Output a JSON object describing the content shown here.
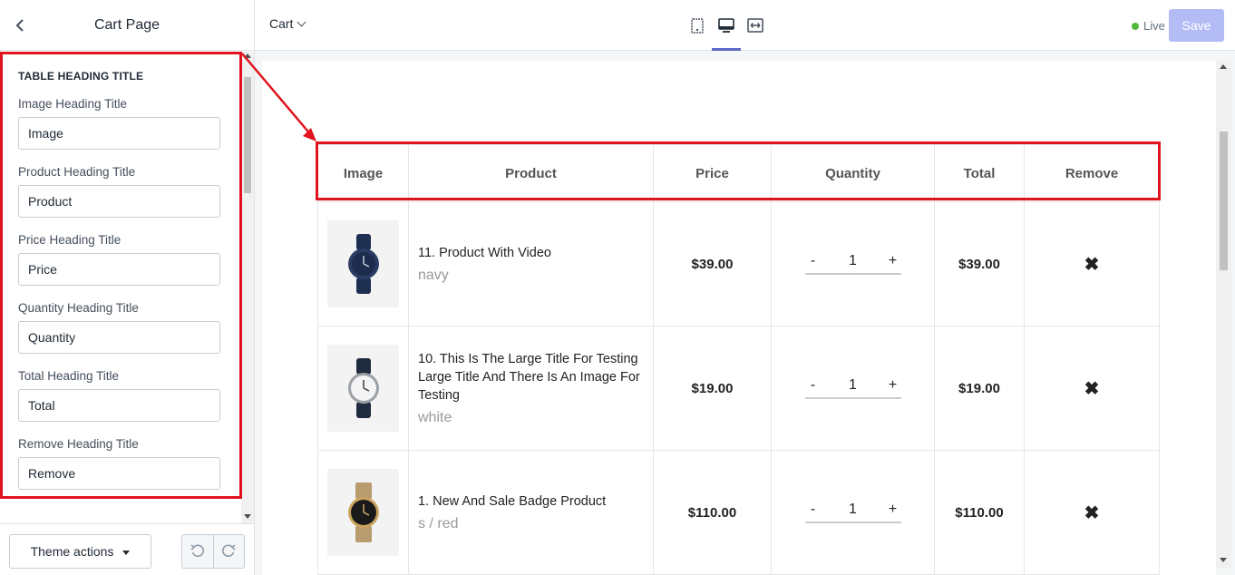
{
  "sidebar": {
    "title": "Cart Page",
    "section_title": "TABLE HEADING TITLE",
    "fields": [
      {
        "label": "Image Heading Title",
        "value": "Image"
      },
      {
        "label": "Product Heading Title",
        "value": "Product"
      },
      {
        "label": "Price Heading Title",
        "value": "Price"
      },
      {
        "label": "Quantity Heading Title",
        "value": "Quantity"
      },
      {
        "label": "Total Heading Title",
        "value": "Total"
      },
      {
        "label": "Remove Heading Title",
        "value": "Remove"
      }
    ],
    "theme_actions_label": "Theme actions"
  },
  "topbar": {
    "page_select": "Cart",
    "status": "Live",
    "save_label": "Save",
    "status_color": "#50b83c"
  },
  "table": {
    "headers": [
      "Image",
      "Product",
      "Price",
      "Quantity",
      "Total",
      "Remove"
    ],
    "rows": [
      {
        "name": "11. Product With Video",
        "variant": "navy",
        "price": "$39.00",
        "qty": "1",
        "total": "$39.00"
      },
      {
        "name": "10. This Is The Large Title For Testing Large Title And There Is An Image For Testing",
        "variant": "white",
        "price": "$19.00",
        "qty": "1",
        "total": "$19.00"
      },
      {
        "name": "1. New And Sale Badge Product",
        "variant": "s / red",
        "price": "$110.00",
        "qty": "1",
        "total": "$110.00"
      }
    ],
    "minus": "-",
    "plus": "+",
    "remove_glyph": "✖"
  },
  "colors": {
    "accent": "#5c6ac4",
    "annotation": "#e0141e"
  }
}
